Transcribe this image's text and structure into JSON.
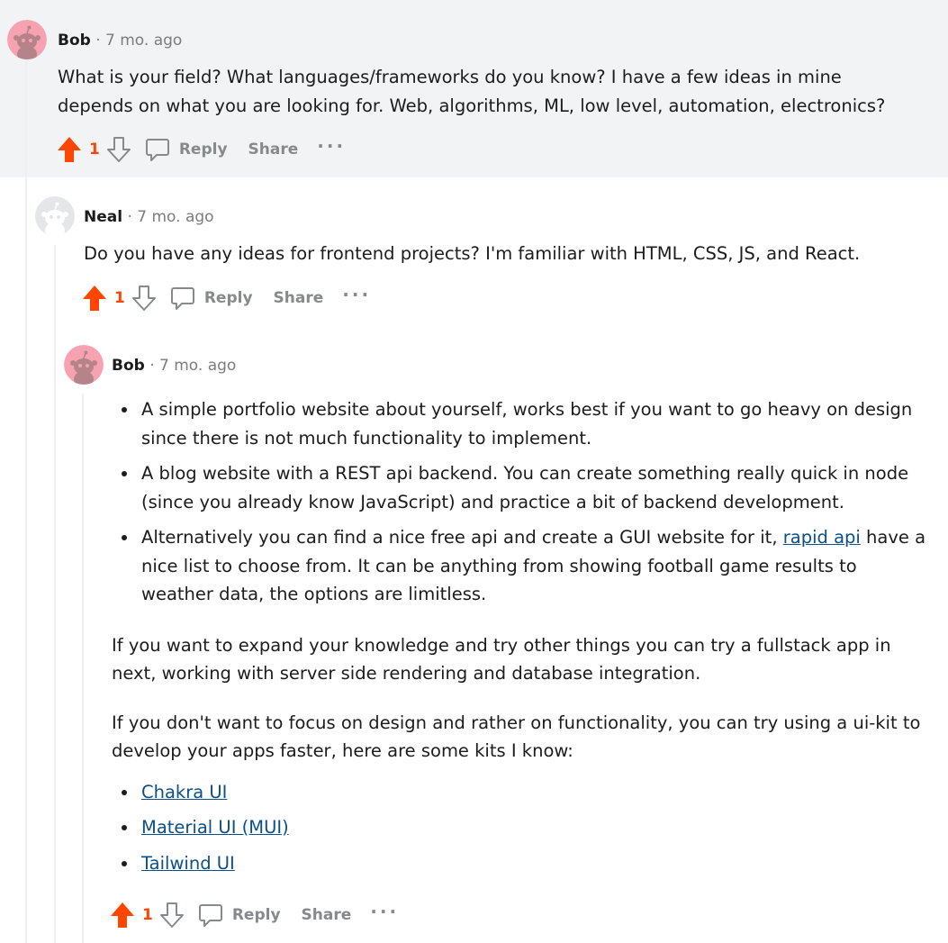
{
  "comments": [
    {
      "author": "Bob",
      "separator": "·",
      "time": "7 mo. ago",
      "text": "What is your field? What languages/frameworks do you know? I have a few ideas in mine depends on what you are looking for. Web, algorithms, ML, low level, automation, electronics?",
      "score": "1",
      "reply_label": "Reply",
      "share_label": "Share",
      "more_label": "···"
    },
    {
      "author": "Neal",
      "separator": "·",
      "time": "7 mo. ago",
      "text": "Do you have any ideas for frontend projects? I'm familiar with HTML, CSS, JS, and React.",
      "score": "1",
      "reply_label": "Reply",
      "share_label": "Share",
      "more_label": "···"
    },
    {
      "author": "Bob",
      "separator": "·",
      "time": "7 mo. ago",
      "bullets": [
        {
          "text": "A simple portfolio website about yourself, works best if you want to go heavy on design since there is not much functionality to implement."
        },
        {
          "text": "A blog website with a REST api backend. You can create something really quick in node (since you already know JavaScript) and practice a bit of backend development."
        },
        {
          "text_before": "Alternatively you can find a nice free api and create a GUI website for it, ",
          "link": "rapid api",
          "text_after": " have a nice list to choose from. It can be anything from showing football game results to weather data, the options are limitless."
        }
      ],
      "paragraph1": "If you want to expand your knowledge and try other things you can try a fullstack app in next, working with server side rendering and database integration.",
      "paragraph2": "If you don't want to focus on design and rather on functionality, you can try using a ui-kit to develop your apps faster, here are some kits I know:",
      "kits": [
        "Chakra UI",
        "Material UI (MUI)",
        "Tailwind UI"
      ],
      "score": "1",
      "reply_label": "Reply",
      "share_label": "Share",
      "more_label": "···"
    }
  ],
  "colors": {
    "upvote": "#ff4500",
    "highlight_bg": "#f1f3f5",
    "link": "#0b4f8b",
    "muted": "#878a8c"
  },
  "icons": [
    "snoo-avatar-pink",
    "snoo-avatar-default",
    "upvote-icon",
    "downvote-icon",
    "comment-bubble-icon",
    "more-icon"
  ]
}
